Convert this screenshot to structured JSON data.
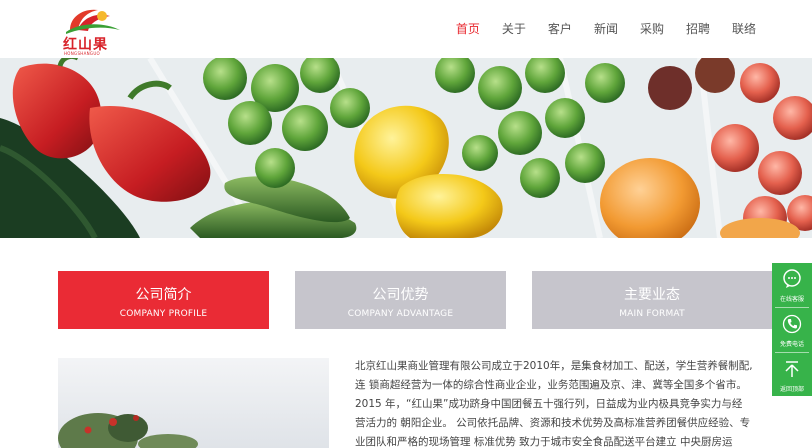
{
  "brand": {
    "logo_text": "红山果",
    "logo_sub": "HONGSHANGUO",
    "accent": "#e8282f",
    "green": "#37b34a"
  },
  "nav": {
    "items": [
      {
        "label": "首页"
      },
      {
        "label": "关于"
      },
      {
        "label": "客户"
      },
      {
        "label": "新闻"
      },
      {
        "label": "采购"
      },
      {
        "label": "招聘"
      },
      {
        "label": "联络"
      }
    ]
  },
  "tabs": [
    {
      "cn": "公司简介",
      "en": "COMPANY PROFILE"
    },
    {
      "cn": "公司优势",
      "en": "COMPANY ADVANTAGE"
    },
    {
      "cn": "主要业态",
      "en": "MAIN FORMAT"
    }
  ],
  "intro": {
    "lines": [
      "北京红山果商业管理有限公司成立于2010年，是集食材加工、配送，学生营养餐制配,",
      "连 锁商超经营为一体的综合性商业企业，业务范围遍及京、津、冀等全国多个省市。",
      "2015 年，“红山果”成功跻身中国团餐五十强行列，日益成为业内极具竞争实力与经",
      "营活力的 朝阳企业。 公司依托品牌、资源和技术优势及高标准营养团餐供应经验、专",
      "业团队和严格的现场管理 标准优势 致力于城市安全食品配送平台建立 中央厨房运"
    ]
  },
  "side": {
    "items": [
      {
        "label": "在线客服",
        "icon": "chat-icon"
      },
      {
        "label": "免费电话",
        "icon": "phone-icon"
      },
      {
        "label": "返回顶部",
        "icon": "back-to-top-icon"
      }
    ]
  }
}
